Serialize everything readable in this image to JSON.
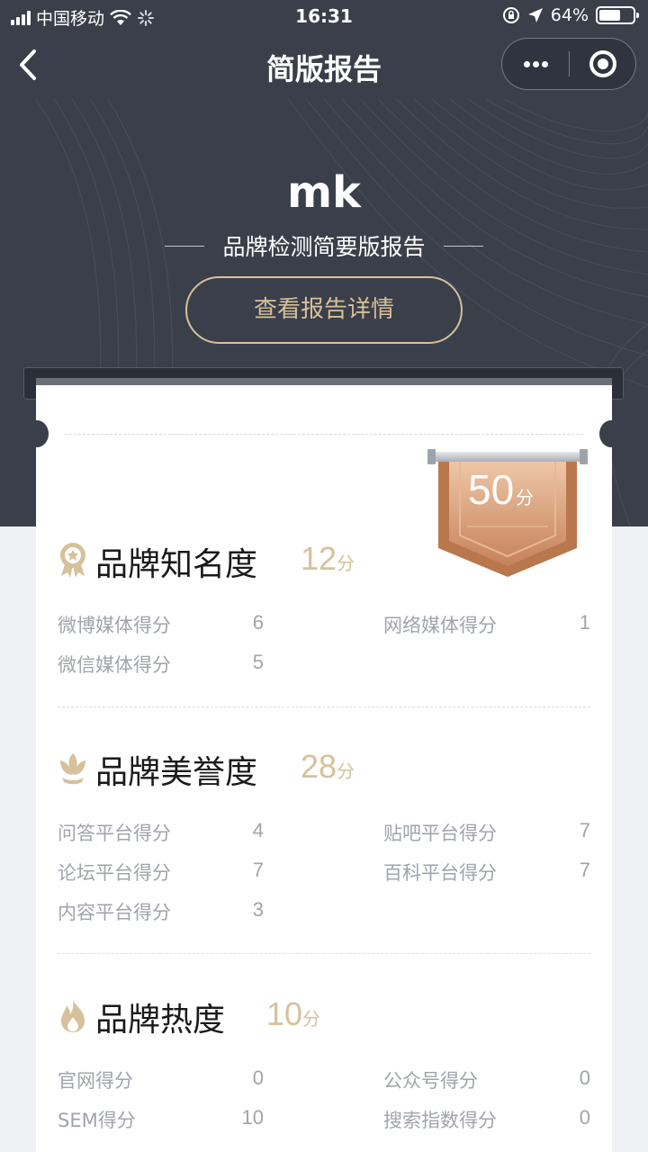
{
  "status_bar": {
    "carrier": "中国移动",
    "time": "16:31",
    "battery": "64%",
    "battery_level": 0.64
  },
  "nav": {
    "title": "简版报告"
  },
  "hero": {
    "name": "mk",
    "subtitle": "品牌检测简要版报告",
    "detail_button": "查看报告详情"
  },
  "total": {
    "value": "50",
    "unit": "分"
  },
  "sections": [
    {
      "title": "品牌知名度",
      "score": "12",
      "unit": "分",
      "icon": "award-medal-icon",
      "metrics": [
        {
          "label": "微博媒体得分",
          "value": "6"
        },
        {
          "label": "网络媒体得分",
          "value": "1"
        },
        {
          "label": "微信媒体得分",
          "value": "5"
        }
      ]
    },
    {
      "title": "品牌美誉度",
      "score": "28",
      "unit": "分",
      "icon": "lotus-flower-icon",
      "metrics": [
        {
          "label": "问答平台得分",
          "value": "4"
        },
        {
          "label": "贴吧平台得分",
          "value": "7"
        },
        {
          "label": "论坛平台得分",
          "value": "7"
        },
        {
          "label": "百科平台得分",
          "value": "7"
        },
        {
          "label": "内容平台得分",
          "value": "3"
        }
      ]
    },
    {
      "title": "品牌热度",
      "score": "10",
      "unit": "分",
      "icon": "flame-icon",
      "metrics": [
        {
          "label": "官网得分",
          "value": "0"
        },
        {
          "label": "公众号得分",
          "value": "0"
        },
        {
          "label": "SEM得分",
          "value": "10"
        },
        {
          "label": "搜索指数得分",
          "value": "0"
        }
      ]
    }
  ],
  "colors": {
    "hero_bg": "#3a3f4a",
    "accent_gold": "#d6c19a",
    "badge_copper": "#c8865c",
    "text_muted": "#a0a4ab"
  }
}
